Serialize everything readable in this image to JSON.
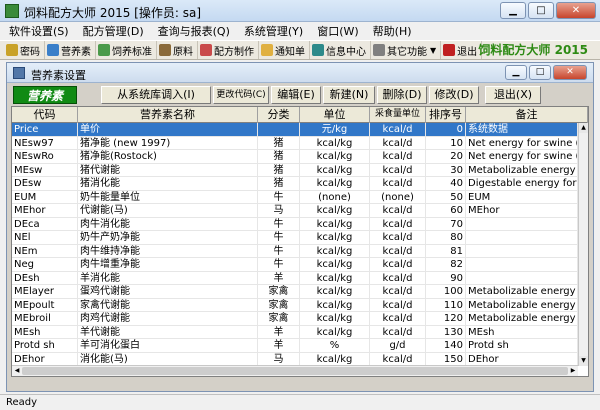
{
  "app": {
    "title": "饲料配方大师 2015   [操作员: sa]"
  },
  "window_controls": {
    "minimize": "▁",
    "maximize": "□",
    "close": "✕"
  },
  "menu": [
    "软件设置(S)",
    "配方管理(D)",
    "查询与报表(Q)",
    "系统管理(Y)",
    "窗口(W)",
    "帮助(H)"
  ],
  "toolbar": {
    "items": [
      {
        "label": "密码",
        "icon": "key-icon",
        "color": "#c9a227"
      },
      {
        "label": "营养素",
        "icon": "nutrient-icon",
        "color": "#3a7fc9"
      },
      {
        "label": "饲养标准",
        "icon": "standard-icon",
        "color": "#4a9a4a"
      },
      {
        "label": "原料",
        "icon": "ingredient-icon",
        "color": "#8a6a3a"
      },
      {
        "label": "配方制作",
        "icon": "formula-icon",
        "color": "#c94a4a"
      },
      {
        "label": "通知单",
        "icon": "notice-icon",
        "color": "#e0b040"
      },
      {
        "label": "信息中心",
        "icon": "info-center-icon",
        "color": "#2d8a8a"
      },
      {
        "label": "其它功能",
        "icon": "more-icon",
        "color": "#808080"
      },
      {
        "label": "退出",
        "icon": "exit-icon",
        "color": "#c02020"
      }
    ],
    "brand": "饲料配方大师  2015"
  },
  "child_window": {
    "title": "营养素设置"
  },
  "buttons": {
    "tag": "营养素",
    "import": "从系统库调入(I)",
    "change_code": "更改代码(C)",
    "edit": "编辑(E)",
    "new": "新建(N)",
    "delete": "删除(D)",
    "modify": "修改(D)",
    "exit": "退出(X)"
  },
  "table": {
    "columns": [
      "代码",
      "营养素名称",
      "分类",
      "单位",
      "采食量单位",
      "排序号",
      "备注"
    ],
    "rows": [
      [
        "Price",
        "单价",
        "",
        "元/kg",
        "kcal/d",
        "0",
        "系统数据"
      ],
      [
        "NEsw97",
        "猪净能 (new 1997)",
        "猪",
        "kcal/kg",
        "kcal/d",
        "10",
        "Net energy for swine (new"
      ],
      [
        "NEswRo",
        "猪净能(Rostock)",
        "猪",
        "kcal/kg",
        "kcal/d",
        "20",
        "Net energy for swine (Rost"
      ],
      [
        "MEsw",
        "猪代谢能",
        "猪",
        "kcal/kg",
        "kcal/d",
        "30",
        "Metabolizable energy for s"
      ],
      [
        "DEsw",
        "猪消化能",
        "猪",
        "kcal/kg",
        "kcal/d",
        "40",
        "Digestable energy for swir"
      ],
      [
        "EUM",
        "奶牛能量单位",
        "牛",
        "(none)",
        "(none)",
        "50",
        "EUM"
      ],
      [
        "MEhor",
        "代谢能(马)",
        "马",
        "kcal/kg",
        "kcal/d",
        "60",
        "MEhor"
      ],
      [
        "DEca",
        "肉牛消化能",
        "牛",
        "kcal/kg",
        "kcal/d",
        "70",
        ""
      ],
      [
        "NEl",
        "奶牛产奶净能",
        "牛",
        "kcal/kg",
        "kcal/d",
        "80",
        ""
      ],
      [
        "NEm",
        "肉牛维持净能",
        "牛",
        "kcal/kg",
        "kcal/d",
        "81",
        ""
      ],
      [
        "Neg",
        "肉牛增重净能",
        "牛",
        "kcal/kg",
        "kcal/d",
        "82",
        ""
      ],
      [
        "DEsh",
        "羊消化能",
        "羊",
        "kcal/kg",
        "kcal/d",
        "90",
        ""
      ],
      [
        "MElayer",
        "蛋鸡代谢能",
        "家禽",
        "kcal/kg",
        "kcal/d",
        "100",
        "Metabolizable energy layir"
      ],
      [
        "MEpoult",
        "家禽代谢能",
        "家禽",
        "kcal/kg",
        "kcal/d",
        "110",
        "Metabolizable energy pou"
      ],
      [
        "MEbroil",
        "肉鸡代谢能",
        "家禽",
        "kcal/kg",
        "kcal/d",
        "120",
        "Metabolizable energy broi"
      ],
      [
        "MEsh",
        "羊代谢能",
        "羊",
        "kcal/kg",
        "kcal/d",
        "130",
        "MEsh"
      ],
      [
        "Protd sh",
        "羊可消化蛋白",
        "羊",
        "%",
        "g/d",
        "140",
        "Protd sh"
      ],
      [
        "DEhor",
        "消化能(马)",
        "马",
        "kcal/kg",
        "kcal/d",
        "150",
        "DEhor"
      ]
    ],
    "selected_row": 0,
    "selection_color": "#3177c8"
  },
  "status_bar": {
    "text": "Ready"
  }
}
